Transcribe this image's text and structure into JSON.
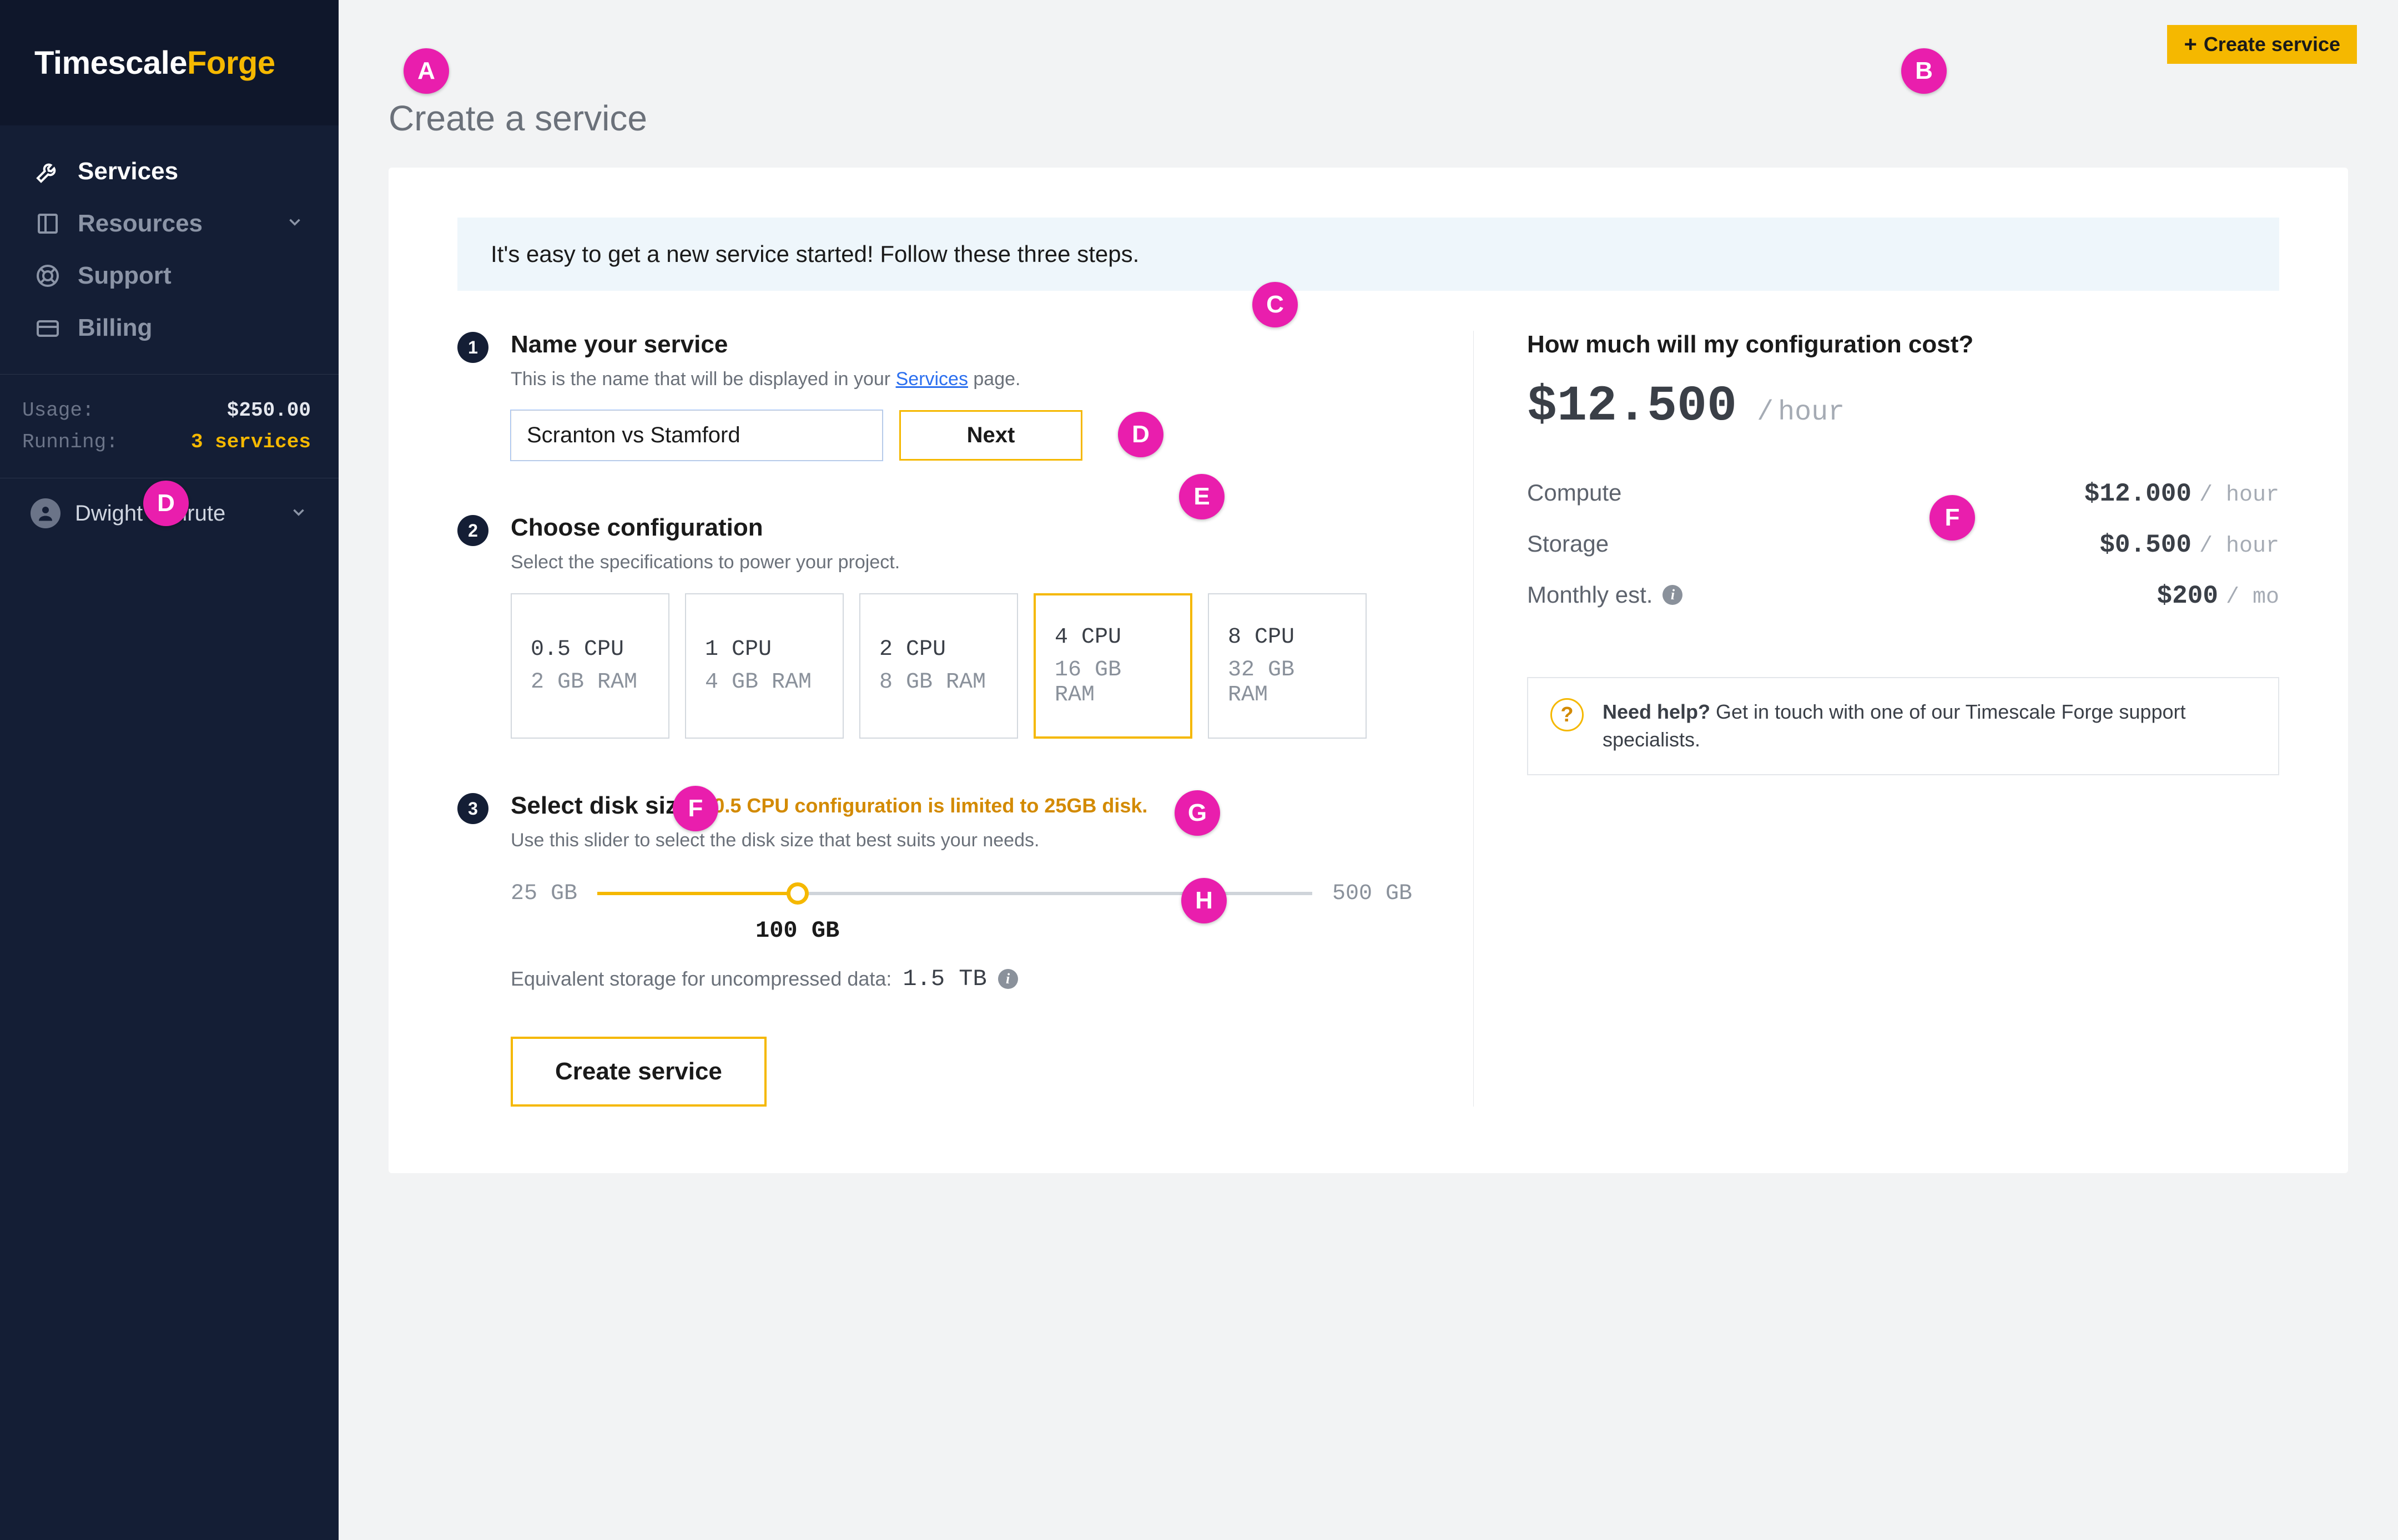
{
  "brand": {
    "left": "Timescale",
    "right": "Forge"
  },
  "nav": {
    "services": "Services",
    "resources": "Resources",
    "support": "Support",
    "billing": "Billing"
  },
  "stats": {
    "usage_label": "Usage:",
    "usage_value": "$250.00",
    "running_label": "Running:",
    "running_value": "3 services"
  },
  "user": {
    "name": "Dwight Schrute"
  },
  "header_button": "Create service",
  "page_title": "Create a service",
  "banner_text": "It's easy to get a new service started! Follow these three steps.",
  "step1": {
    "num": "1",
    "title": "Name your service",
    "subtitle_pre": "This is the name that will be displayed in your ",
    "subtitle_link": "Services",
    "subtitle_post": " page.",
    "input_value": "Scranton vs Stamford",
    "next": "Next"
  },
  "step2": {
    "num": "2",
    "title": "Choose configuration",
    "subtitle": "Select the specifications to power your project.",
    "tiles": [
      {
        "cpu": "0.5 CPU",
        "ram": "2 GB RAM"
      },
      {
        "cpu": "1 CPU",
        "ram": "4 GB RAM"
      },
      {
        "cpu": "2 CPU",
        "ram": "8 GB RAM"
      },
      {
        "cpu": "4 CPU",
        "ram": "16 GB RAM"
      },
      {
        "cpu": "8 CPU",
        "ram": "32 GB RAM"
      }
    ],
    "selected_index": 3
  },
  "step3": {
    "num": "3",
    "title": "Select disk size",
    "warning": "0.5 CPU configuration is limited to 25GB disk.",
    "subtitle": "Use this slider to select the disk size that best suits your needs.",
    "min": "25 GB",
    "max": "500 GB",
    "value_label": "100 GB",
    "value_percent": 28,
    "equiv_label": "Equivalent storage for uncompressed data:",
    "equiv_value": "1.5 TB"
  },
  "create_button": "Create service",
  "cost": {
    "title": "How much will my configuration cost?",
    "total": "$12.500",
    "total_unit": "hour",
    "lines": {
      "compute_label": "Compute",
      "compute_value": "$12.000",
      "compute_unit": "hour",
      "storage_label": "Storage",
      "storage_value": "$0.500",
      "storage_unit": "hour",
      "monthly_label": "Monthly est.",
      "monthly_value": "$200",
      "monthly_unit": "mo"
    }
  },
  "help": {
    "bold": "Need help?",
    "rest": " Get in touch with one of our Timescale Forge support specialists."
  },
  "annotations": [
    "A",
    "B",
    "C",
    "D",
    "D",
    "E",
    "F",
    "F",
    "G",
    "H"
  ]
}
